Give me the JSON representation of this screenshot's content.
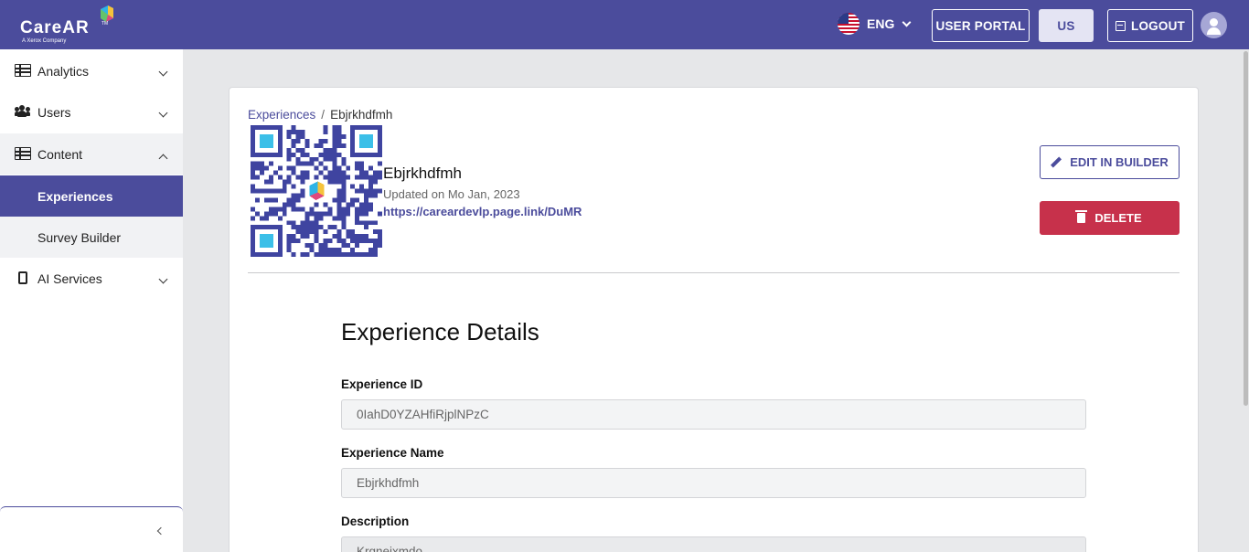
{
  "header": {
    "logo_text": "CareAR",
    "logo_tagline": "A Xerox Company",
    "logo_tm": "TM",
    "language": "ENG",
    "user_portal_label": "USER PORTAL",
    "region_label": "US",
    "logout_label": "LOGOUT"
  },
  "sidebar": {
    "items": [
      {
        "label": "Analytics",
        "icon": "table-icon"
      },
      {
        "label": "Users",
        "icon": "users-icon"
      },
      {
        "label": "Content",
        "icon": "table-icon"
      },
      {
        "label": "Experiences",
        "active": true
      },
      {
        "label": "Survey Builder"
      },
      {
        "label": "AI Services",
        "icon": "chip-icon"
      }
    ]
  },
  "breadcrumb": {
    "parent": "Experiences",
    "separator": "/",
    "current": "Ebjrkhdfmh"
  },
  "experience": {
    "name": "Ebjrkhdfmh",
    "updated": "Updated on Mo Jan, 2023",
    "link": "https://careardevlp.page.link/DuMR"
  },
  "actions": {
    "edit_label": "EDIT IN BUILDER",
    "delete_label": "DELETE"
  },
  "details": {
    "title": "Experience Details",
    "fields": [
      {
        "label": "Experience ID",
        "value": "0IahD0YZAHfiRjplNPzC"
      },
      {
        "label": "Experience Name",
        "value": "Ebjrkhdfmh"
      },
      {
        "label": "Description",
        "value": "Krqneixmdo"
      }
    ]
  },
  "colors": {
    "brand": "#4b4c9c",
    "danger": "#c7314b",
    "qr": "#3f44a0",
    "qr_finder_center": "#3bbfe8"
  }
}
